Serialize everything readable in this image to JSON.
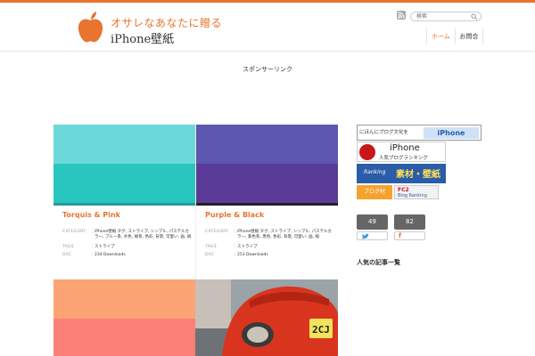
{
  "header": {
    "logo_line1": "オサレなあなたに贈る",
    "logo_line2": "iPhone壁紙",
    "search_placeholder": "検索",
    "nav": [
      {
        "label": "ホーム"
      },
      {
        "label": "お問合"
      }
    ]
  },
  "notice": "スポンサーリンク",
  "cards": [
    {
      "title": "Torquis & Pink",
      "top_color": "#6bd9d9",
      "bottom_color": "#29c6c0",
      "underline_color": "#2a9b99",
      "meta": {
        "category_key": "CATEGORY",
        "category_value": "iPhone壁紙 タグ, ストライプ, シンプル, パステルカラー, ブルー系, 水色, 緑系, 色彩, 背景, 可愛い, 画, 縞",
        "tags_key": "TAGS",
        "tags_value": "ストライプ",
        "dl_key": "DSC",
        "dl_value": "234 Downloads"
      }
    },
    {
      "title": "Purple & Black",
      "top_color": "#5c57b0",
      "bottom_color": "#5a3b98",
      "underline_color": "#222222",
      "meta": {
        "category_key": "CATEGORY",
        "category_value": "iPhone壁紙 タグ, ストライプ, シンプル, パステルカラー, 紫色系, 黒色, 色彩, 背景, 可愛い, 画, 縞",
        "tags_key": "TAGS",
        "tags_value": "ストライプ",
        "dl_key": "DSC",
        "dl_value": "253 Downloads"
      }
    },
    {
      "title": "",
      "top_color": "#fca473",
      "bottom_color": "#fd8078",
      "underline_color": "#fd8078"
    }
  ],
  "photo": {
    "plate": "2CJ"
  },
  "sidebar": {
    "banner1_left": "にほんにブログ文化を",
    "banner1_right": "iPhone",
    "banner2_title": "iPhone",
    "banner2_sub": "人気ブログランキング",
    "banner3_left": "Ranking",
    "banner3_right": "素材・壁紙",
    "banner4_left": "ブログ村",
    "banner4_fc2": "FC2",
    "banner4_sub": "Blog Ranking",
    "tw_count": "49",
    "fb_count": "82",
    "heading": "人気の記事一覧"
  },
  "colors": {
    "accent": "#e8742e"
  }
}
